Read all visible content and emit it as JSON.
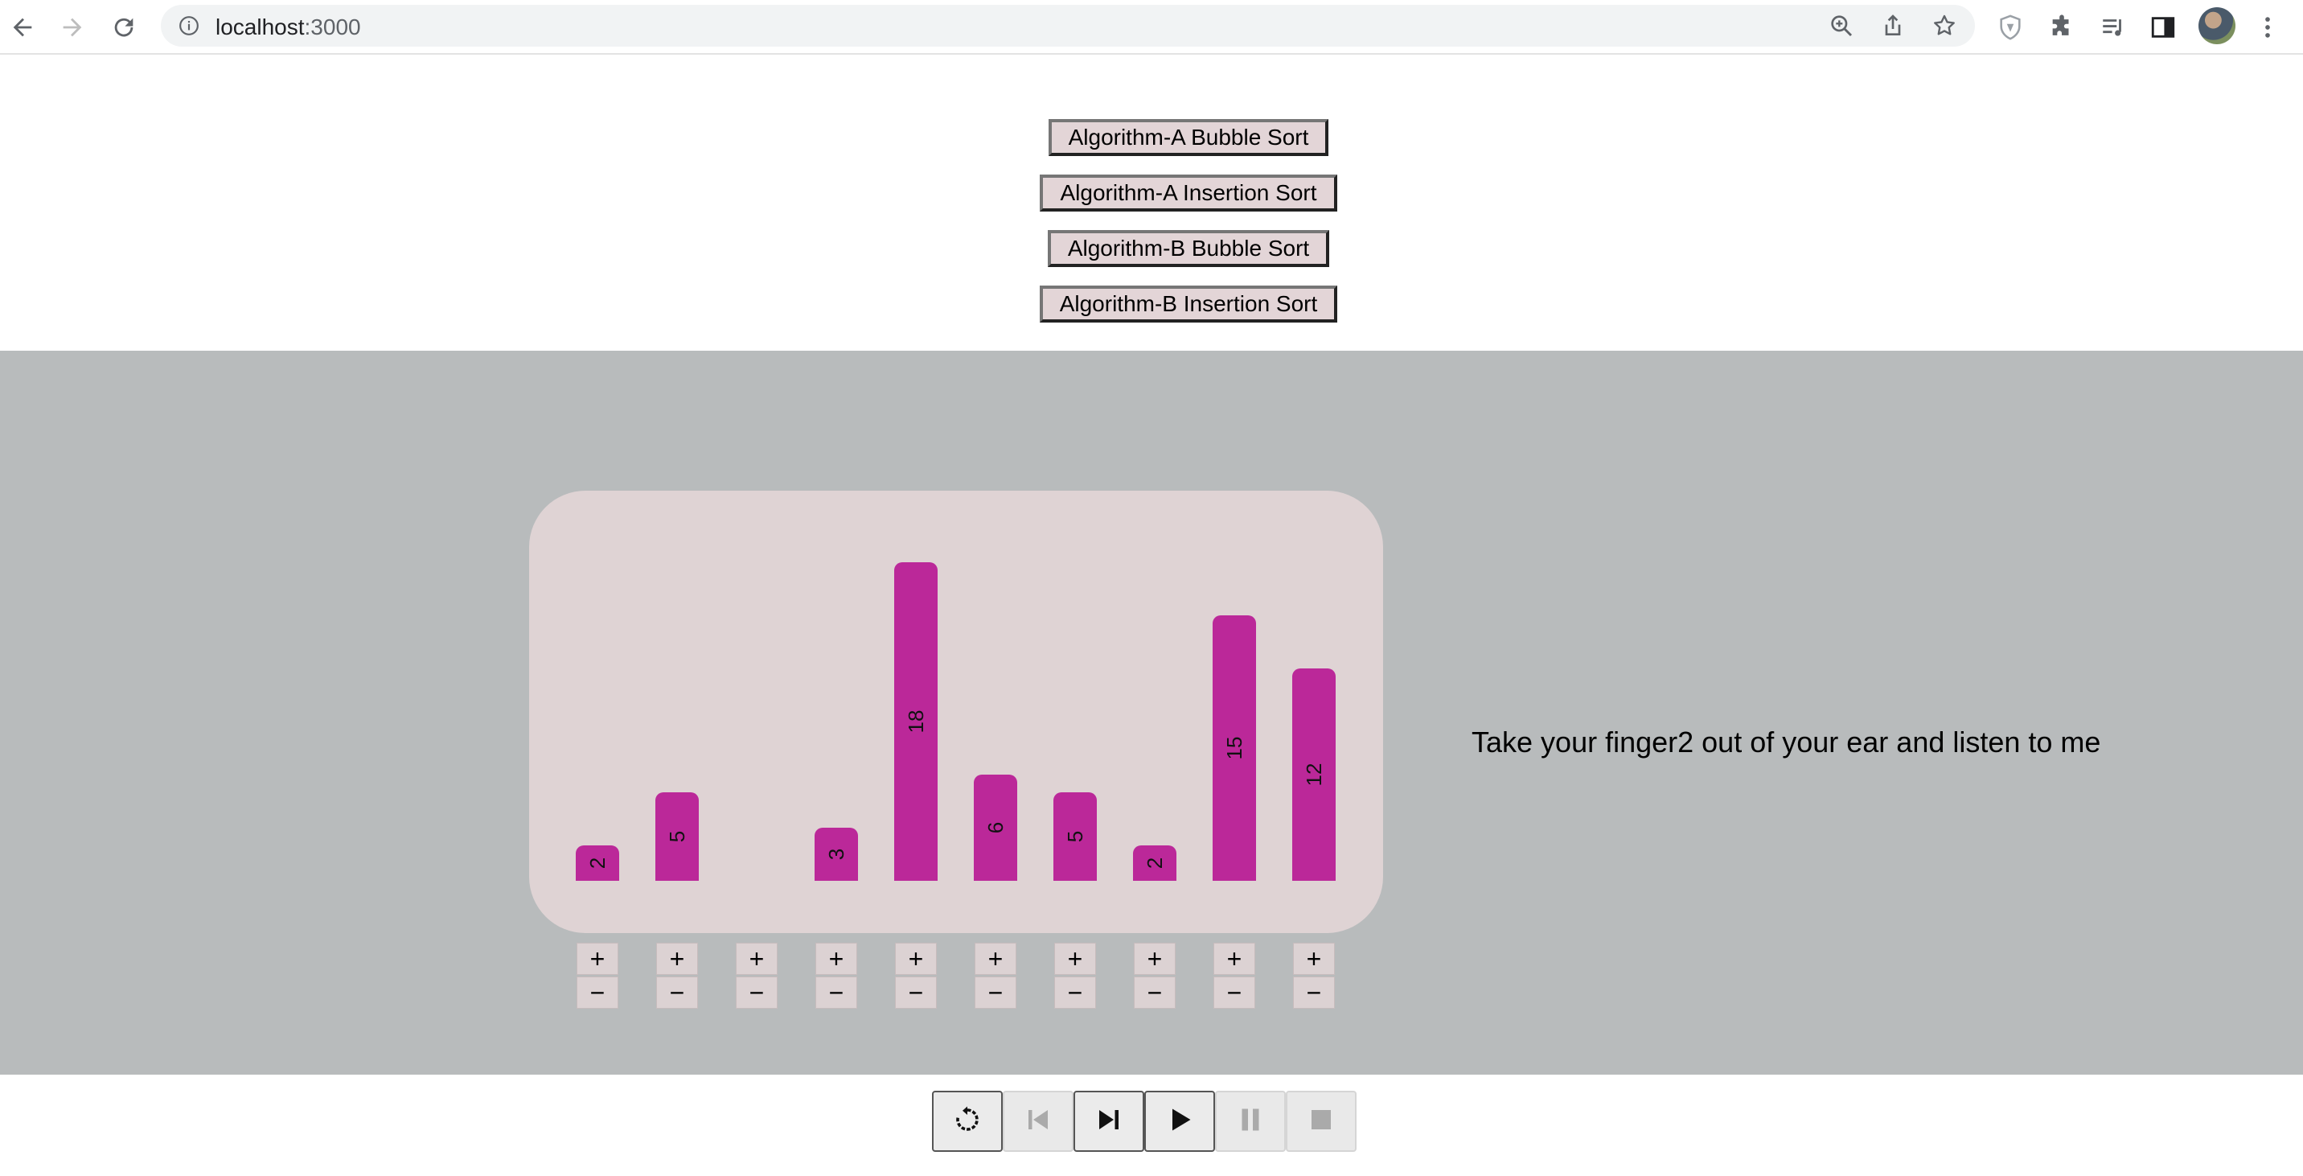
{
  "browser": {
    "url_host": "localhost",
    "url_port": ":3000",
    "icons": [
      "back-icon",
      "forward-icon",
      "reload-icon",
      "info-icon",
      "zoom-icon",
      "share-icon",
      "star-icon",
      "shield-icon",
      "extensions-icon",
      "media-icon",
      "side-panel-icon",
      "avatar",
      "menu-icon"
    ]
  },
  "algorithms": [
    {
      "label": "Algorithm-A Bubble Sort"
    },
    {
      "label": "Algorithm-A Insertion Sort"
    },
    {
      "label": "Algorithm-B Bubble Sort"
    },
    {
      "label": "Algorithm-B Insertion Sort"
    }
  ],
  "chart_data": {
    "type": "bar",
    "values": [
      2,
      5,
      0,
      3,
      18,
      6,
      5,
      2,
      15,
      12
    ],
    "labels": [
      "2",
      "5",
      "",
      "3",
      "18",
      "6",
      "5",
      "2",
      "15",
      "12"
    ],
    "bar_color": "#bb2899"
  },
  "controls": {
    "plus": "+",
    "minus": "−"
  },
  "message": "Take your finger2 out of your ear and listen to me",
  "player": {
    "buttons": [
      {
        "name": "reset-button",
        "icon": "reset-icon",
        "enabled": true
      },
      {
        "name": "step-back-button",
        "icon": "skip-back-icon",
        "enabled": false
      },
      {
        "name": "step-forward-button",
        "icon": "skip-forward-icon",
        "enabled": true
      },
      {
        "name": "play-button",
        "icon": "play-icon",
        "enabled": true
      },
      {
        "name": "pause-button",
        "icon": "pause-icon",
        "enabled": false
      },
      {
        "name": "stop-button",
        "icon": "stop-icon",
        "enabled": false
      }
    ]
  },
  "colors": {
    "panel": "#b8bbbc",
    "card": "#dfd3d4",
    "bar": "#bb2899",
    "button": "#e3d5d7"
  }
}
